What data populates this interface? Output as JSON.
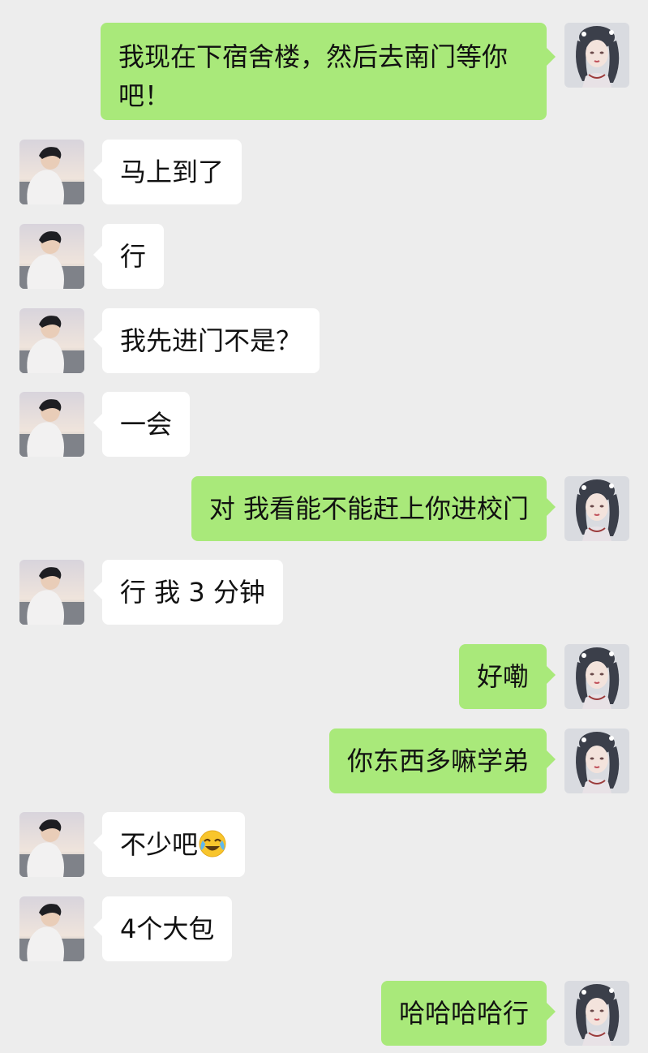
{
  "chat": {
    "messages": [
      {
        "side": "right",
        "text": "我现在下宿舍楼，然后去南门等你吧！"
      },
      {
        "side": "left",
        "text": "马上到了"
      },
      {
        "side": "left",
        "text": "行"
      },
      {
        "side": "left",
        "text": "我先进门不是？"
      },
      {
        "side": "left",
        "text": "一会"
      },
      {
        "side": "right",
        "text": "对 我看能不能赶上你进校门"
      },
      {
        "side": "left",
        "text": "行 我 3 分钟"
      },
      {
        "side": "right",
        "text": "好嘞"
      },
      {
        "side": "right",
        "text": "你东西多嘛学弟"
      },
      {
        "side": "left",
        "text": "不少吧",
        "emoji": "crying-laughing-emoji"
      },
      {
        "side": "left",
        "text": "4个大包"
      },
      {
        "side": "right",
        "text": "哈哈哈哈行"
      }
    ]
  },
  "colors": {
    "background": "#ededed",
    "incoming_bubble": "#ffffff",
    "outgoing_bubble": "#a9e97a",
    "text": "#111111"
  },
  "icons": {
    "contact_avatar": "boy-avatar-photo",
    "self_avatar": "girl-avatar-illustration"
  }
}
